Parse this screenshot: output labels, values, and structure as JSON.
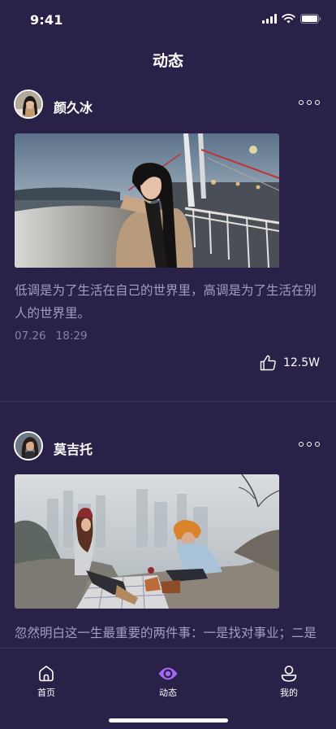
{
  "status_bar": {
    "time": "9:41"
  },
  "header": {
    "title": "动态"
  },
  "posts": [
    {
      "username": "颜久冰",
      "text": "低调是为了生活在自己的世界里，高调是为了生活在别人的世界里。",
      "date": "07.26",
      "time": "18:29",
      "likes": "12.5W"
    },
    {
      "username": "莫吉托",
      "text": "忽然明白这一生最重要的两件事：一是找对事业；二是"
    }
  ],
  "tab_bar": {
    "items": [
      {
        "label": "首页",
        "icon": "home-icon"
      },
      {
        "label": "动态",
        "icon": "eye-icon",
        "active": true
      },
      {
        "label": "我的",
        "icon": "profile-icon"
      }
    ],
    "active_color": "#a06bf2"
  },
  "colors": {
    "background": "#2a2149",
    "text_primary": "#ffffff",
    "text_secondary": "#a59cc4",
    "text_meta": "#8a819f",
    "divider": "#3c335e"
  }
}
